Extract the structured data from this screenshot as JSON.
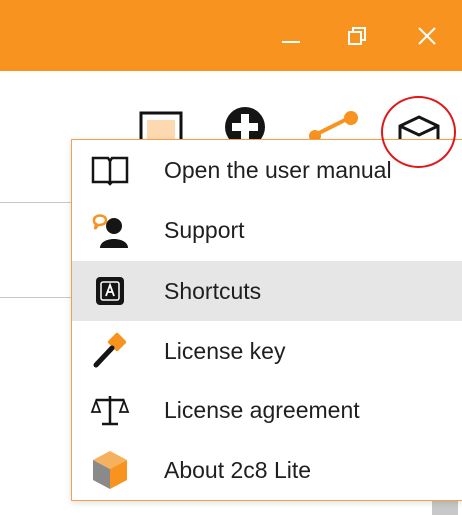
{
  "titlebar": {
    "color": "#f7931e",
    "buttons": [
      {
        "name": "minimize",
        "icon": "minimize-icon"
      },
      {
        "name": "restore",
        "icon": "restore-icon"
      },
      {
        "name": "close",
        "icon": "close-icon"
      }
    ]
  },
  "toolbar": {
    "icons": [
      "window-icon",
      "add-icon",
      "share-icon",
      "package-icon"
    ]
  },
  "help_menu": {
    "items": [
      {
        "label": "Open the user manual",
        "icon": "book-icon",
        "highlighted": false
      },
      {
        "label": "Support",
        "icon": "support-icon",
        "highlighted": false
      },
      {
        "label": "Shortcuts",
        "icon": "keyboard-key-icon",
        "highlighted": true
      },
      {
        "label": "License key",
        "icon": "key-icon",
        "highlighted": false
      },
      {
        "label": "License agreement",
        "icon": "scales-icon",
        "highlighted": false
      },
      {
        "label": "About 2c8 Lite",
        "icon": "cube-icon",
        "highlighted": false
      }
    ]
  },
  "annotation": {
    "color": "#e01818"
  }
}
